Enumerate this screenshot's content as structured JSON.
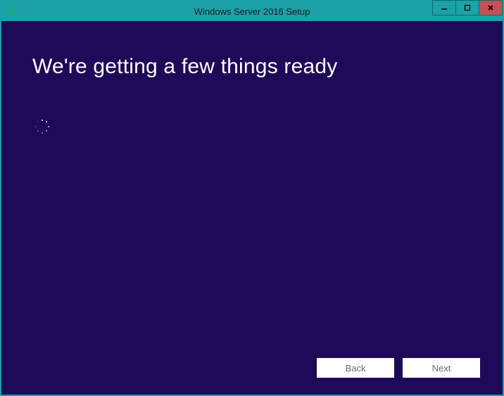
{
  "window": {
    "title": "Windows Server 2016 Setup"
  },
  "content": {
    "heading": "We're getting a few things ready"
  },
  "buttons": {
    "back": "Back",
    "next": "Next"
  }
}
